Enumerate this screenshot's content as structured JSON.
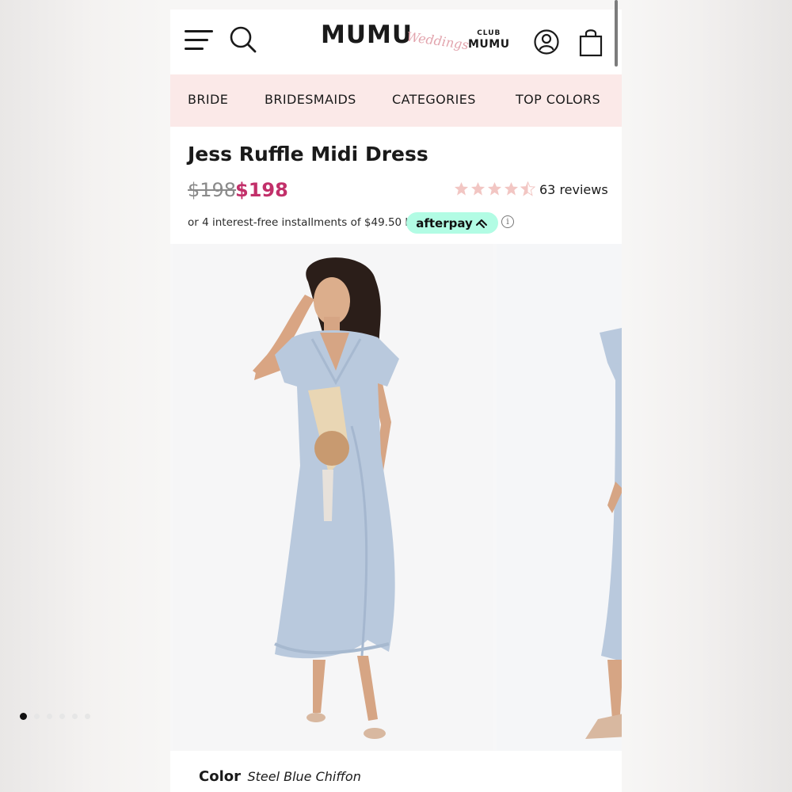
{
  "header": {
    "logo_text": "MUMU",
    "logo_script": "Weddings",
    "club_top": "CLUB",
    "club_bottom": "MUMU",
    "icons": [
      "menu-icon",
      "search-icon",
      "account-icon",
      "shopping-bag-icon"
    ]
  },
  "nav": {
    "items": [
      {
        "label": "BRIDE"
      },
      {
        "label": "BRIDESMAIDS"
      },
      {
        "label": "CATEGORIES"
      },
      {
        "label": "TOP COLORS"
      }
    ]
  },
  "product": {
    "title": "Jess Ruffle Midi Dress",
    "price_original": "$198",
    "price_current": "$198",
    "rating": 4.5,
    "rating_max": 5,
    "reviews": "63 reviews",
    "installments_text": "or 4 interest-free installments of $49.50 by",
    "afterpay_label": "afterpay"
  },
  "gallery": {
    "image_count": 6,
    "active_index": 0
  },
  "color": {
    "label": "Color",
    "value": "Steel Blue Chiffon"
  },
  "colors": {
    "nav_bg": "#fbe9e8",
    "sale_price": "#c2306a",
    "afterpay_bg": "#b2fce4",
    "star": "#f2c6c3",
    "dress": "#b9c9dd"
  }
}
